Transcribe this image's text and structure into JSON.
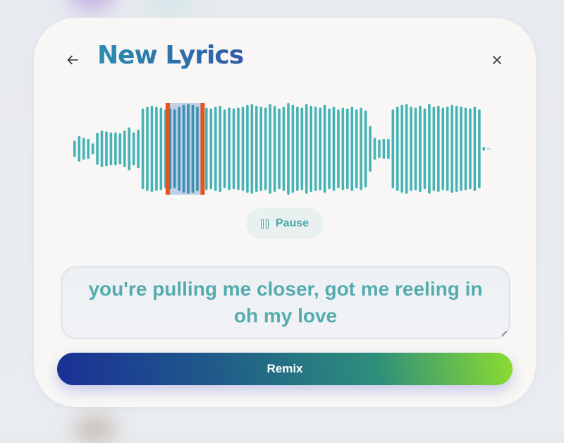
{
  "header": {
    "title": "New Lyrics",
    "back_icon": "arrow-left-icon",
    "close_icon": "close-icon"
  },
  "waveform": {
    "bar_color": "#45b3b5",
    "selection_color": "#e4541f",
    "amplitudes": [
      0.18,
      0.28,
      0.24,
      0.22,
      0.12,
      0.35,
      0.4,
      0.38,
      0.36,
      0.36,
      0.34,
      0.4,
      0.47,
      0.36,
      0.42,
      0.88,
      0.92,
      0.94,
      0.92,
      0.9,
      0.86,
      0.88,
      0.86,
      0.92,
      0.96,
      0.98,
      0.96,
      0.92,
      0.94,
      0.9,
      0.88,
      0.92,
      0.94,
      0.86,
      0.9,
      0.88,
      0.9,
      0.92,
      0.96,
      0.98,
      0.94,
      0.92,
      0.9,
      0.98,
      0.94,
      0.88,
      0.92,
      1.0,
      0.96,
      0.92,
      0.9,
      0.98,
      0.94,
      0.92,
      0.9,
      0.96,
      0.88,
      0.92,
      0.86,
      0.9,
      0.88,
      0.92,
      0.86,
      0.9,
      0.84,
      0.5,
      0.24,
      0.2,
      0.22,
      0.22,
      0.86,
      0.92,
      0.96,
      0.98,
      0.92,
      0.9,
      0.94,
      0.88,
      0.98,
      0.92,
      0.94,
      0.9,
      0.92,
      0.96,
      0.94,
      0.92,
      0.9,
      0.88,
      0.92,
      0.86,
      0.04
    ],
    "selection_start": 0.225,
    "selection_end": 0.307
  },
  "controls": {
    "pause_label": "Pause",
    "pause_icon": "pause-icon"
  },
  "lyrics": {
    "line1": "you're pulling me closer, got me reeling in",
    "line2": "oh my love"
  },
  "actions": {
    "remix_label": "Remix"
  }
}
